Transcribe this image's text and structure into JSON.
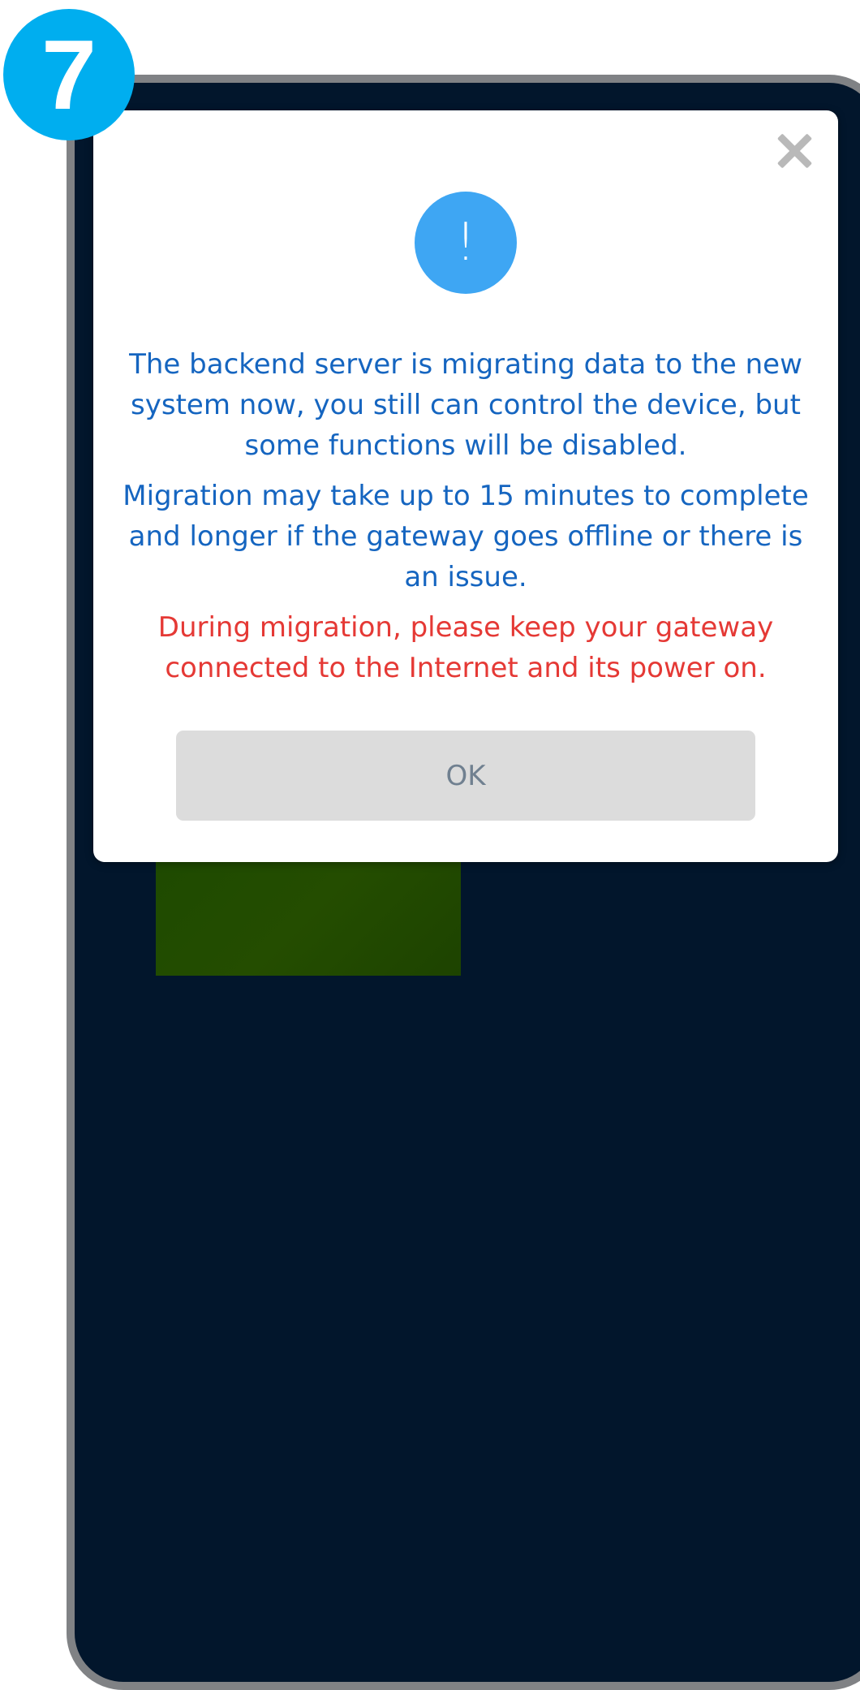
{
  "step_badge": {
    "number": "7"
  },
  "dialog": {
    "icon": {
      "name": "exclamation-icon",
      "glyph": "!"
    },
    "close_icon": "close-icon",
    "messages": {
      "migration_notice": "The backend server is migrating data to the new system now, you still can control the device, but some functions will be disabled.",
      "duration_notice": "Migration may take up to 15 minutes to complete and longer if the gateway goes offline or there is an issue.",
      "warning": "During migration, please keep your gateway connected to the Internet and its power on."
    },
    "ok_label": "OK"
  },
  "colors": {
    "badge": "#00aeef",
    "phone_bg": "#02162c",
    "phone_frame": "#808285",
    "icon_bg": "#3ea6f3",
    "info_text": "#1565c0",
    "warning_text": "#e53935",
    "ok_button_bg": "#dcdcdc",
    "ok_button_text": "#708090"
  }
}
